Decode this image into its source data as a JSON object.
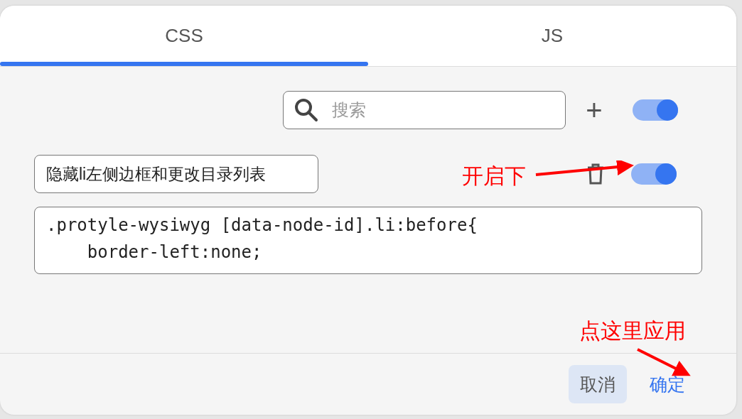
{
  "tabs": [
    {
      "label": "CSS",
      "selected": true
    },
    {
      "label": "JS",
      "selected": false
    }
  ],
  "toolbar": {
    "search": {
      "placeholder": "搜索"
    },
    "add_button": "+",
    "global_toggle": {
      "on": true
    }
  },
  "snippets": [
    {
      "name": "隐藏li左侧边框和更改目录列表",
      "on": true,
      "code": ".protyle-wysiwyg [data-node-id].li:before{\n    border-left:none;"
    }
  ],
  "annotations": [
    {
      "text": "开启下"
    },
    {
      "text": "点这里应用"
    }
  ],
  "buttons": [
    {
      "label": "取消",
      "kind": "cancel"
    },
    {
      "label": "确定",
      "kind": "confirm"
    }
  ]
}
